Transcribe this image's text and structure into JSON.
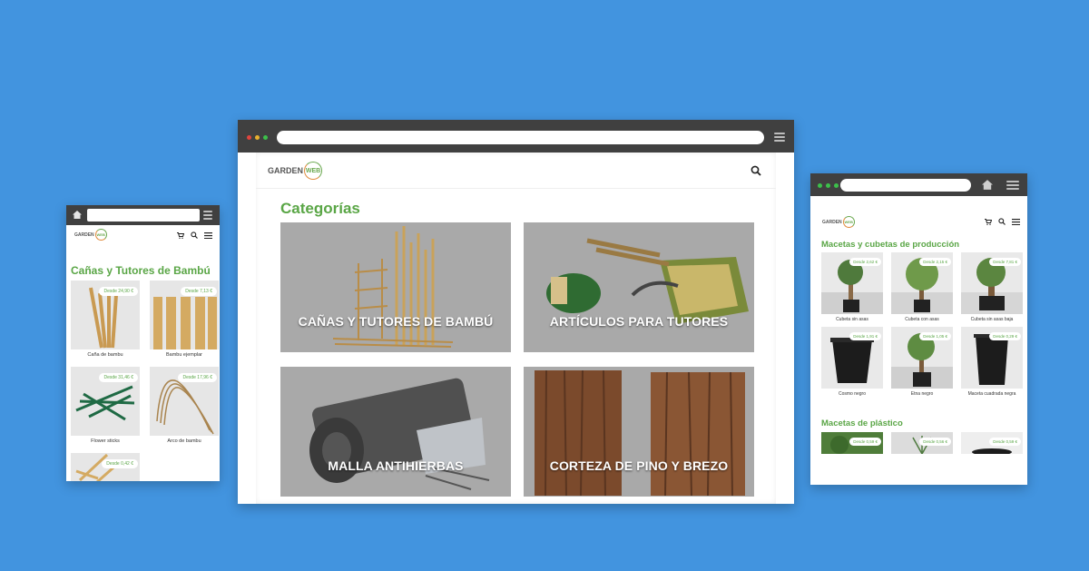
{
  "main_window": {
    "logo": {
      "garden": "GARDEN",
      "web": "WEB"
    },
    "page_title": "Categorías",
    "categories": [
      {
        "label": "CAÑAS Y TUTORES DE BAMBÚ"
      },
      {
        "label": "ARTÍCULOS PARA TUTORES"
      },
      {
        "label": "MALLA ANTIHIERBAS"
      },
      {
        "label": "CORTEZA DE PINO Y BREZO"
      }
    ]
  },
  "left_window": {
    "logo": {
      "garden": "GARDEN",
      "web": "WEB"
    },
    "page_title": "Cañas y Tutores de Bambú",
    "products": [
      {
        "name": "Caña de bambu",
        "price": "Desde 24,90 €"
      },
      {
        "name": "Bambu ejemplar",
        "price": "Desde 7,13 €"
      },
      {
        "name": "Flower sticks",
        "price": "Desde 31,46 €"
      },
      {
        "name": "Arco de bambu",
        "price": "Desde 17,96 €"
      },
      {
        "name": "",
        "price": "Desde 0,42 €"
      }
    ]
  },
  "right_window": {
    "logo": {
      "garden": "GARDEN",
      "web": "WEB"
    },
    "section1_title": "Macetas y cubetas de producción",
    "section1_products": [
      {
        "name": "Cubeta sin asas",
        "price": "Desde 2,62 €"
      },
      {
        "name": "Cubeta con asas",
        "price": "Desde 2,15 €"
      },
      {
        "name": "Cubeta sin asas baja",
        "price": "Desde 7,81 €"
      },
      {
        "name": "Cosmo negro",
        "price": "Desde 1,91 €"
      },
      {
        "name": "Etna negro",
        "price": "Desde 1,05 €"
      },
      {
        "name": "Maceta cuadrada negra",
        "price": "Desde 0,29 €"
      }
    ],
    "section2_title": "Macetas de plástico",
    "section2_products": [
      {
        "price": "Desde 0,59 €"
      },
      {
        "price": "Desde 0,56 €"
      },
      {
        "price": "Desde 0,59 €"
      }
    ]
  },
  "colors": {
    "background": "#4294df",
    "accent_green": "#5aa646",
    "bar": "#404040"
  }
}
